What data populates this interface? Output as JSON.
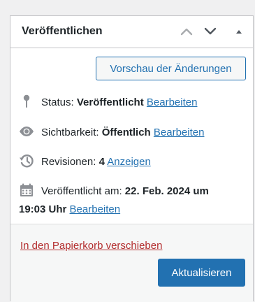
{
  "panel": {
    "title": "Veröffentlichen",
    "move_up_icon": "chevron-up-icon",
    "move_down_icon": "chevron-down-icon",
    "toggle_icon": "triangle-up-icon"
  },
  "preview": {
    "label": "Vorschau der Änderungen"
  },
  "status": {
    "icon": "pin-icon",
    "label": "Status:",
    "value": "Veröffentlicht",
    "edit_link": "Bearbeiten"
  },
  "visibility": {
    "icon": "eye-icon",
    "label": "Sichtbarkeit:",
    "value": "Öffentlich",
    "edit_link": "Bearbeiten"
  },
  "revisions": {
    "icon": "history-icon",
    "label": "Revisionen:",
    "value": "4",
    "view_link": "Anzeigen"
  },
  "published": {
    "icon": "calendar-icon",
    "label": "Veröffentlicht am:",
    "date_line1": "22. Feb. 2024 um",
    "date_line2": "19:03 Uhr",
    "edit_link": "Bearbeiten"
  },
  "actions": {
    "trash_link": "In den Papierkorb verschieben",
    "update_button": "Aktualisieren"
  },
  "colors": {
    "accent": "#2271b1",
    "danger": "#b32d2e",
    "icon_gray": "#8c8f94"
  }
}
